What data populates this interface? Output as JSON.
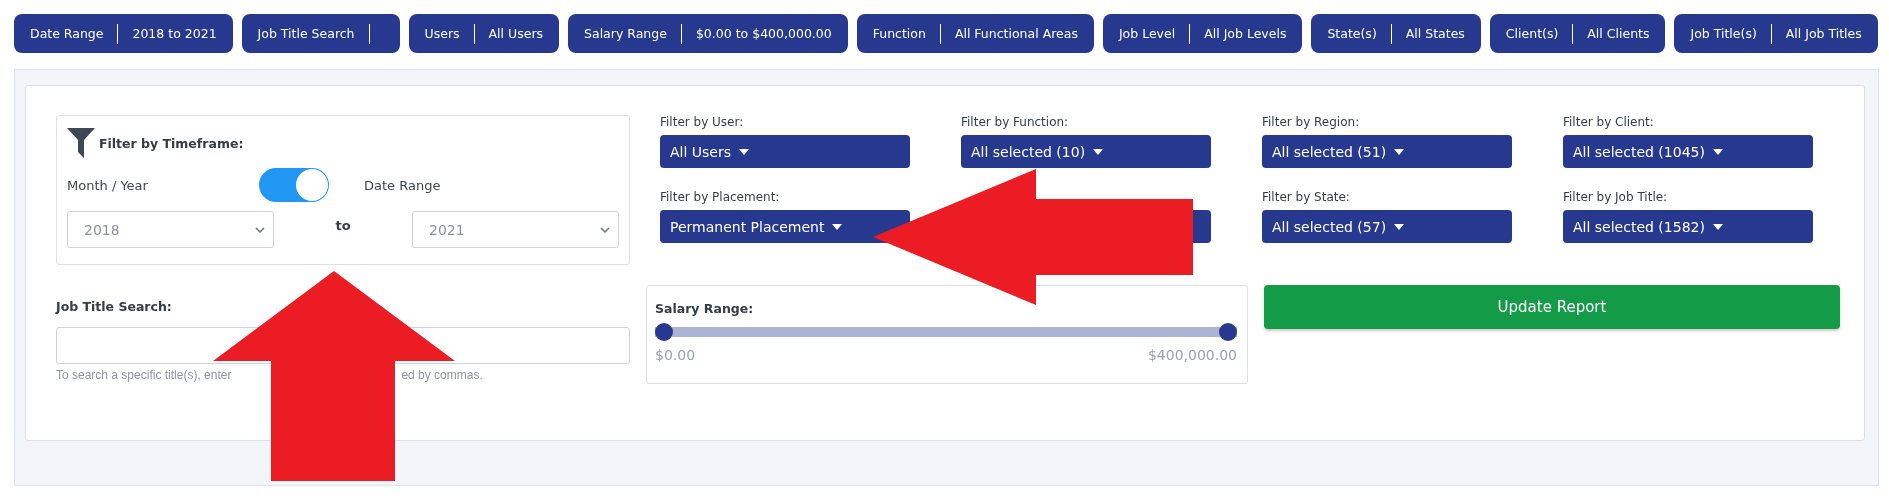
{
  "chips": [
    {
      "label": "Date Range",
      "value": "2018 to 2021"
    },
    {
      "label": "Job Title Search"
    },
    {
      "label": "Users",
      "value": "All Users"
    },
    {
      "label": "Salary Range",
      "value": "$0.00 to $400,000.00"
    },
    {
      "label": "Function",
      "value": "All Functional Areas"
    },
    {
      "label": "Job Level",
      "value": "All Job Levels"
    },
    {
      "label": "State(s)",
      "value": "All States"
    },
    {
      "label": "Client(s)",
      "value": "All Clients"
    },
    {
      "label": "Job Title(s)",
      "value": "All Job Titles"
    }
  ],
  "timeframe": {
    "title": "Filter by Timeframe:",
    "left_label": "Month / Year",
    "right_label": "Date Range",
    "toggle_on": true,
    "from": "2018",
    "separator": "to",
    "to": "2021"
  },
  "job_title_search": {
    "label": "Job Title Search:",
    "helper_parts": [
      "To search a specific title(s), enter",
      "ed by commas."
    ]
  },
  "filters": [
    {
      "kind": "dropdown",
      "label": "Filter by User:",
      "value": "All Users"
    },
    {
      "kind": "dropdown",
      "label": "Filter by Function:",
      "value": "All selected (10)"
    },
    {
      "kind": "dropdown",
      "label": "Filter by Region:",
      "value": "All selected (51)"
    },
    {
      "kind": "dropdown",
      "label": "Filter by Client:",
      "value": "All selected (1045)"
    },
    {
      "kind": "dropdown",
      "label": "Filter by Placement:",
      "value": "Permanent Placement"
    },
    {
      "kind": "covered"
    },
    {
      "kind": "dropdown",
      "label": "Filter by State:",
      "value": "All selected (57)"
    },
    {
      "kind": "dropdown",
      "label": "Filter by Job Title:",
      "value": "All selected (1582)"
    }
  ],
  "salary": {
    "label": "Salary Range:",
    "low": {
      "level": 0,
      "reading": "$0.00"
    },
    "high": {
      "level": 1,
      "reading": "$400,000.00"
    }
  },
  "update_button": "Update Report"
}
